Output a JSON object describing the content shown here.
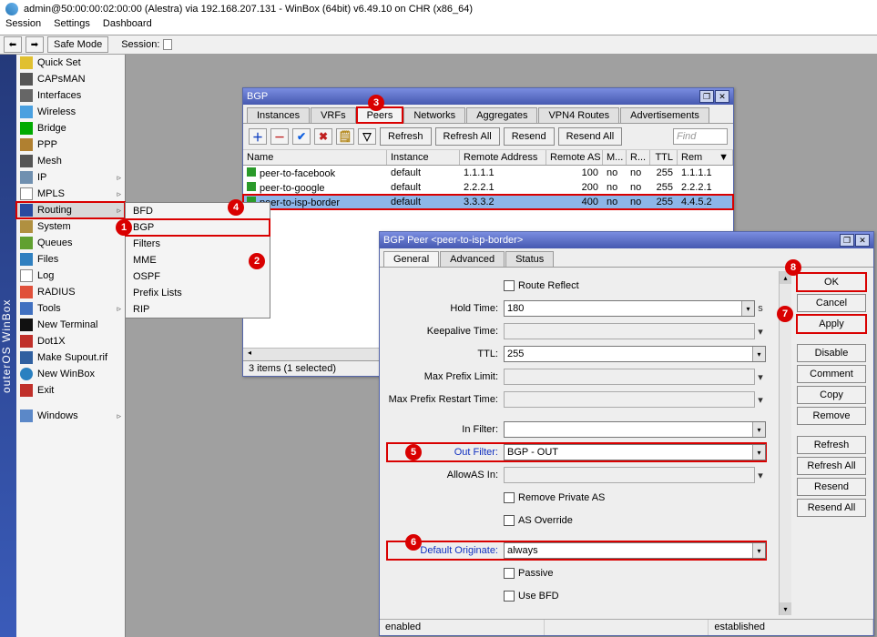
{
  "window_title": "admin@50:00:00:02:00:00 (Alestra) via 192.168.207.131 - WinBox (64bit) v6.49.10 on CHR (x86_64)",
  "menubar": [
    "Session",
    "Settings",
    "Dashboard"
  ],
  "toolbar": {
    "safe_mode": "Safe Mode",
    "session_label": "Session:"
  },
  "sidebar_title": "outerOS WinBox",
  "side": {
    "quick": "Quick Set",
    "caps": "CAPsMAN",
    "intf": "Interfaces",
    "wifi": "Wireless",
    "bridge": "Bridge",
    "ppp": "PPP",
    "mesh": "Mesh",
    "ip": "IP",
    "mpls": "MPLS",
    "routing": "Routing",
    "system": "System",
    "queues": "Queues",
    "files": "Files",
    "log": "Log",
    "radius": "RADIUS",
    "tools": "Tools",
    "term": "New Terminal",
    "dot1x": "Dot1X",
    "supout": "Make Supout.rif",
    "newwb": "New WinBox",
    "exit": "Exit",
    "windows": "Windows"
  },
  "flyout": [
    "BFD",
    "BGP",
    "Filters",
    "MME",
    "OSPF",
    "Prefix Lists",
    "RIP"
  ],
  "bgp_window": {
    "title": "BGP",
    "tabs": [
      "Instances",
      "VRFs",
      "Peers",
      "Networks",
      "Aggregates",
      "VPN4 Routes",
      "Advertisements"
    ],
    "btns": {
      "refresh": "Refresh",
      "refresh_all": "Refresh All",
      "resend": "Resend",
      "resend_all": "Resend All",
      "find": "Find"
    },
    "cols": [
      "Name",
      "Instance",
      "Remote Address",
      "Remote AS",
      "M...",
      "R...",
      "TTL",
      "Rem"
    ],
    "rows": [
      {
        "name": "peer-to-facebook",
        "inst": "default",
        "addr": "1.1.1.1",
        "as": "100",
        "m": "no",
        "r": "no",
        "ttl": "255",
        "rem": "1.1.1.1"
      },
      {
        "name": "peer-to-google",
        "inst": "default",
        "addr": "2.2.2.1",
        "as": "200",
        "m": "no",
        "r": "no",
        "ttl": "255",
        "rem": "2.2.2.1"
      },
      {
        "name": "peer-to-isp-border",
        "inst": "default",
        "addr": "3.3.3.2",
        "as": "400",
        "m": "no",
        "r": "no",
        "ttl": "255",
        "rem": "4.4.5.2"
      }
    ],
    "status": "3 items (1 selected)"
  },
  "peer_window": {
    "title": "BGP Peer <peer-to-isp-border>",
    "tabs": [
      "General",
      "Advanced",
      "Status"
    ],
    "fields": {
      "route_reflect": "Route Reflect",
      "hold_time_l": "Hold Time:",
      "hold_time_v": "180",
      "hold_unit": "s",
      "keepalive_l": "Keepalive Time:",
      "keepalive_v": "",
      "ttl_l": "TTL:",
      "ttl_v": "255",
      "maxpref_l": "Max Prefix Limit:",
      "maxpref_v": "",
      "maxprefr_l": "Max Prefix Restart Time:",
      "maxprefr_v": "",
      "infilt_l": "In Filter:",
      "infilt_v": "",
      "outfilt_l": "Out Filter:",
      "outfilt_v": "BGP - OUT",
      "allowas_l": "AllowAS In:",
      "allowas_v": "",
      "removepa": "Remove Private AS",
      "asover": "AS Override",
      "deforig_l": "Default Originate:",
      "deforig_v": "always",
      "passive": "Passive",
      "usebfd": "Use BFD"
    },
    "buttons": [
      "OK",
      "Cancel",
      "Apply",
      "Disable",
      "Comment",
      "Copy",
      "Remove",
      "Refresh",
      "Refresh All",
      "Resend",
      "Resend All"
    ],
    "status_left": "enabled",
    "status_right": "established"
  },
  "badges": {
    "1": "1",
    "2": "2",
    "3": "3",
    "4": "4",
    "5": "5",
    "6": "6",
    "7": "7",
    "8": "8"
  }
}
